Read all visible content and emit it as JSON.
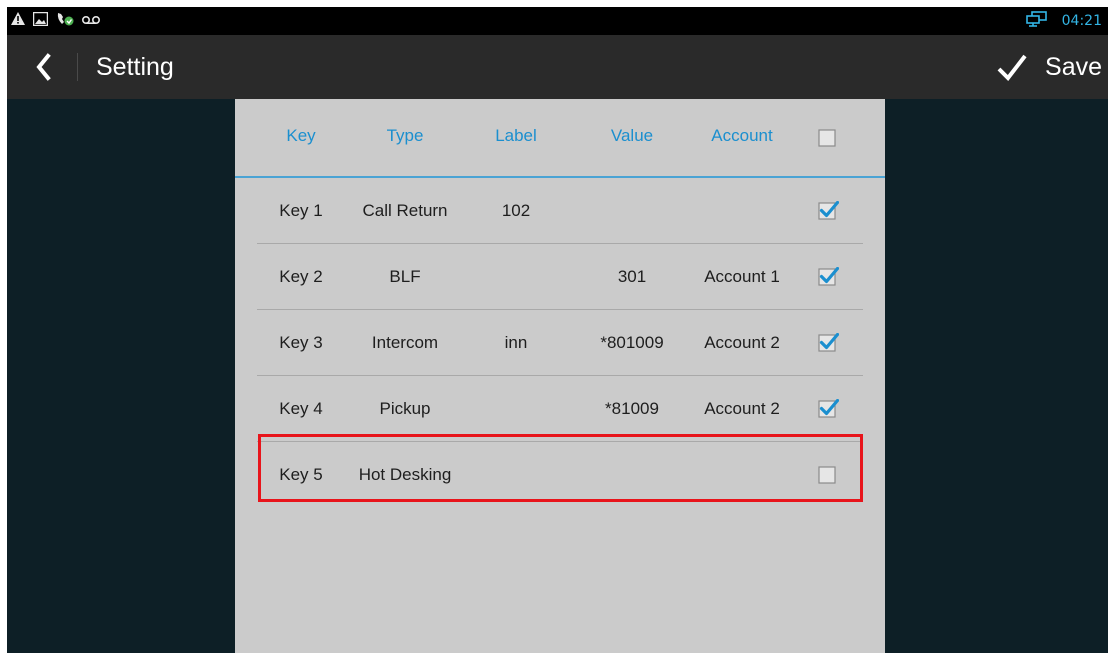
{
  "statusbar": {
    "icons": [
      "warning-icon",
      "image-icon",
      "call-forward-icon",
      "voicemail-icon"
    ],
    "network_icon": "network-icon",
    "time": "04:21"
  },
  "actionbar": {
    "back_icon": "chevron-left-icon",
    "title": "Setting",
    "save_icon": "checkmark-icon",
    "save_label": "Save"
  },
  "table": {
    "columns": [
      "Key",
      "Type",
      "Label",
      "Value",
      "Account"
    ],
    "select_all_checked": false,
    "rows": [
      {
        "key": "Key 1",
        "type": "Call Return",
        "label": "102",
        "value": "",
        "account": "",
        "checked": true
      },
      {
        "key": "Key 2",
        "type": "BLF",
        "label": "",
        "value": "301",
        "account": "Account 1",
        "checked": true
      },
      {
        "key": "Key 3",
        "type": "Intercom",
        "label": "inn",
        "value": "*801009",
        "account": "Account 2",
        "checked": true
      },
      {
        "key": "Key 4",
        "type": "Pickup",
        "label": "",
        "value": "*81009",
        "account": "Account 2",
        "checked": true
      },
      {
        "key": "Key 5",
        "type": "Hot Desking",
        "label": "",
        "value": "",
        "account": "",
        "checked": false
      }
    ]
  },
  "colors": {
    "accent": "#1b8fcf",
    "highlight": "#e8141b",
    "background": "#0d1f26",
    "panel": "#cbcbcb"
  }
}
